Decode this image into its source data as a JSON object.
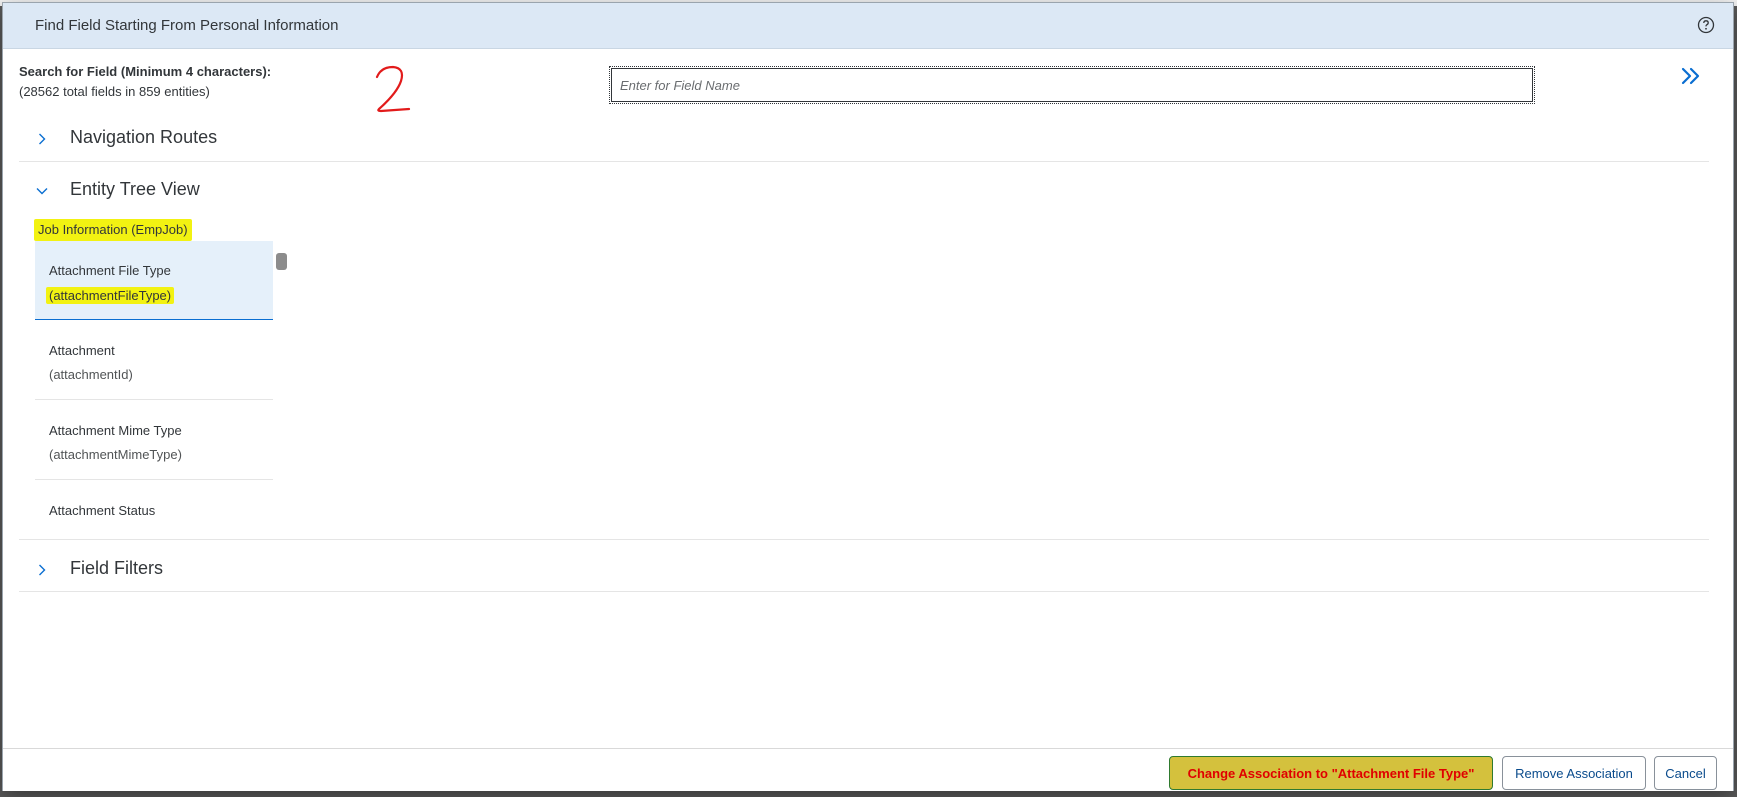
{
  "dialog": {
    "title": "Find Field Starting From Personal Information"
  },
  "search": {
    "label": "Search for Field (Minimum 4 characters):",
    "summary": "(28562 total fields in 859 entities)",
    "placeholder": "Enter for Field Name",
    "value": ""
  },
  "sections": {
    "navigation_routes": "Navigation Routes",
    "entity_tree_view": "Entity Tree View",
    "field_filters": "Field Filters"
  },
  "entity_tree": {
    "entity_label": "Job Information (EmpJob)",
    "items": [
      {
        "name": "Attachment File Type",
        "technical": "(attachmentFileType)",
        "selected": true
      },
      {
        "name": "Attachment",
        "technical": "(attachmentId)",
        "selected": false
      },
      {
        "name": "Attachment Mime Type",
        "technical": "(attachmentMimeType)",
        "selected": false
      },
      {
        "name": "Attachment Status",
        "technical": "",
        "selected": false
      }
    ]
  },
  "footer": {
    "change_association": "Change Association to \"Attachment File Type\"",
    "remove_association": "Remove Association",
    "cancel": "Cancel"
  },
  "colors": {
    "header_bg": "#dce8f5",
    "highlight": "#f2f212",
    "selected_row": "#e5f0fa",
    "accent": "#0a6ed1",
    "primary_button_bg": "#d4c13d",
    "primary_button_text": "#e00000"
  }
}
